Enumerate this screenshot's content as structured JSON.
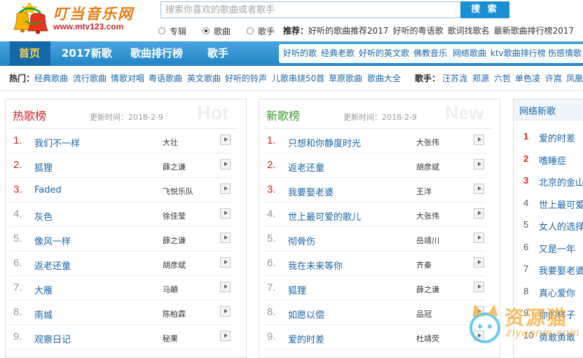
{
  "header": {
    "logo_text": "叮当音乐网",
    "logo_url": "www.mtv123.com",
    "search_placeholder": "搜索你喜欢的歌曲或者歌手",
    "search_button": "搜 索",
    "search_types": [
      "专辑",
      "歌曲",
      "歌手"
    ],
    "selected_type": "歌曲",
    "recommend_label": "推荐：",
    "recommend_links": [
      "好听的歌曲推荐2017",
      "好听的粤语歌",
      "歌词找歌名",
      "最新歌曲排行榜2017"
    ]
  },
  "nav": {
    "main": [
      "首页",
      "2017新歌",
      "歌曲排行榜",
      "歌手"
    ],
    "sub": [
      "好听的歌",
      "经典老歌",
      "好听的英文歌",
      "佛教音乐",
      "网络歌曲",
      "ktv歌曲排行榜",
      "伤感情歌"
    ]
  },
  "hot": {
    "label": "热门：",
    "links": [
      "经典歌曲",
      "流行歌曲",
      "情歌对唱",
      "粤语歌曲",
      "英文歌曲",
      "好听的铃声",
      "儿歌串烧50首",
      "草原歌曲",
      "歌曲大全"
    ],
    "singer_label": "歌手：",
    "singers": [
      "汪苏泷",
      "郑源",
      "六哲",
      "单色凌",
      "许嵩",
      "凤凰传奇"
    ]
  },
  "panels": [
    {
      "title": "热歌榜",
      "updated": "更新时间：2018-2-9",
      "en": "Hot",
      "rows": [
        {
          "num": "1.",
          "song": "我们不一样",
          "artist": "大壮"
        },
        {
          "num": "2.",
          "song": "狐狸",
          "artist": "薛之谦"
        },
        {
          "num": "3.",
          "song": "Faded",
          "artist": "飞悦乐队"
        },
        {
          "num": "4.",
          "song": "灰色",
          "artist": "徐佳莹"
        },
        {
          "num": "5.",
          "song": "像风一样",
          "artist": "薛之谦"
        },
        {
          "num": "6.",
          "song": "返老还童",
          "artist": "胡彦斌"
        },
        {
          "num": "7.",
          "song": "大雁",
          "artist": "马頔"
        },
        {
          "num": "8.",
          "song": "南城",
          "artist": "陈柏霖"
        },
        {
          "num": "9.",
          "song": "观察日记",
          "artist": "秘果"
        }
      ]
    },
    {
      "title": "新歌榜",
      "updated": "更新时间：2018-2-9",
      "en": "New",
      "rows": [
        {
          "num": "1.",
          "song": "只想和你静度时光",
          "artist": "大张伟"
        },
        {
          "num": "2.",
          "song": "返老还童",
          "artist": "胡彦斌"
        },
        {
          "num": "3.",
          "song": "我要娶老婆",
          "artist": "王洋"
        },
        {
          "num": "4.",
          "song": "世上最可爱的歌儿",
          "artist": "大张伟"
        },
        {
          "num": "5.",
          "song": "彻骨伤",
          "artist": "岳靖川"
        },
        {
          "num": "6.",
          "song": "我在未来等你",
          "artist": "齐秦"
        },
        {
          "num": "7.",
          "song": "狐狸",
          "artist": "薛之谦"
        },
        {
          "num": "8.",
          "song": "如愿以偿",
          "artist": "品冠"
        },
        {
          "num": "9.",
          "song": "爱的时差",
          "artist": "杜靖荧"
        }
      ]
    }
  ],
  "network": {
    "title": "网络新歌",
    "rows": [
      {
        "num": "1",
        "song": "爱的时差"
      },
      {
        "num": "2",
        "song": "嗜睡症"
      },
      {
        "num": "3",
        "song": "北京的金山上"
      },
      {
        "num": "4",
        "song": "世上最可爱的歌儿"
      },
      {
        "num": "5",
        "song": "女人的选择"
      },
      {
        "num": "6",
        "song": "又是一年"
      },
      {
        "num": "7",
        "song": "我要娶老婆"
      },
      {
        "num": "8",
        "song": "真心爱你"
      },
      {
        "num": "9",
        "song": "你的样子"
      },
      {
        "num": "10",
        "song": "勇敢勇敢"
      }
    ]
  },
  "watermark": {
    "text": "资源猫",
    "sub": "ziyuanm.com"
  },
  "colors": {
    "accent": "#1b8fd4",
    "nav": "#2284c6",
    "top_rank": "#d2232a",
    "link": "#1a64a8",
    "hot_title": "#d2232a",
    "new_title": "#3a9a2a"
  }
}
